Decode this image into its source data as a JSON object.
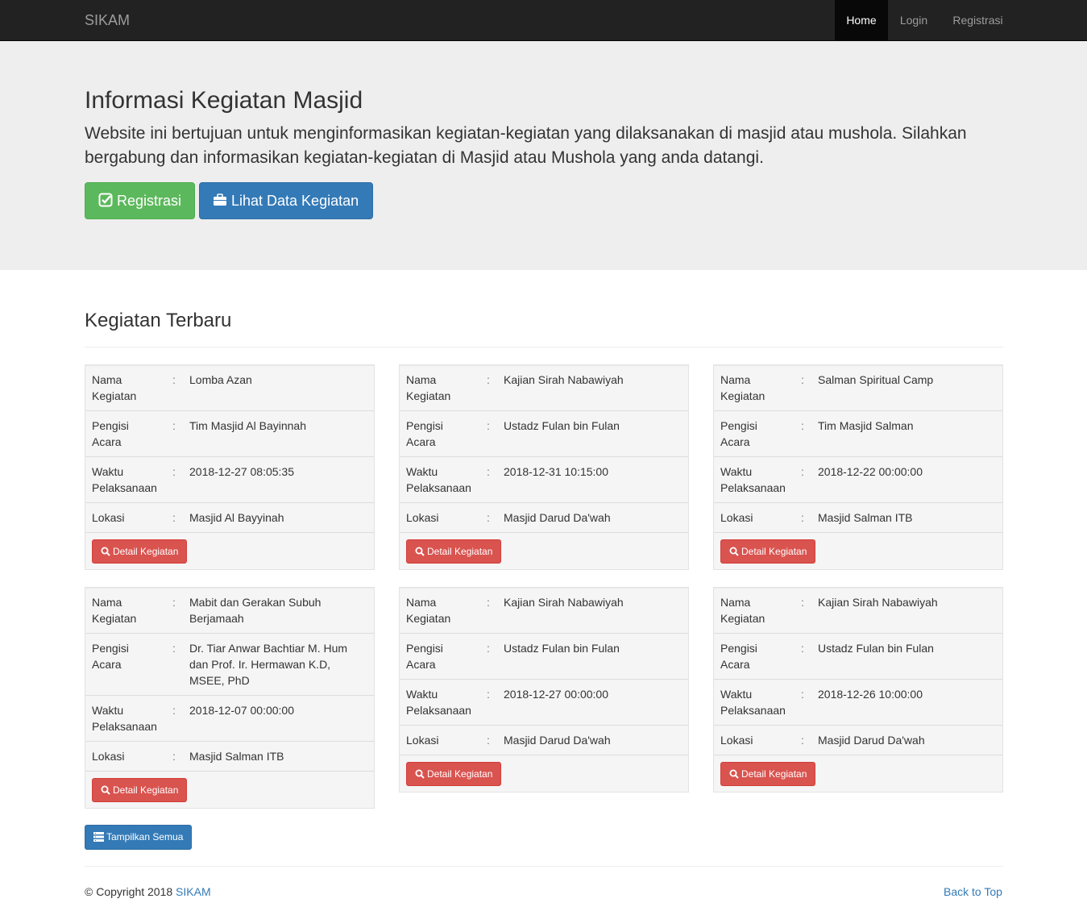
{
  "navbar": {
    "brand": "SIKAM",
    "links": [
      {
        "label": "Home",
        "active": true
      },
      {
        "label": "Login",
        "active": false
      },
      {
        "label": "Registrasi",
        "active": false
      }
    ]
  },
  "hero": {
    "title": "Informasi Kegiatan Masjid",
    "description": "Website ini bertujuan untuk menginformasikan kegiatan-kegiatan yang dilaksanakan di masjid atau mushola. Silahkan bergabung dan informasikan kegiatan-kegiatan di Masjid atau Mushola yang anda datangi.",
    "register_button": {
      "label": "Registrasi",
      "icon": "check-square-icon",
      "color": "#5cb85c"
    },
    "view_button": {
      "label": "Lihat Data Kegiatan",
      "icon": "briefcase-icon",
      "color": "#337ab7"
    }
  },
  "section": {
    "title": "Kegiatan Terbaru",
    "field_labels": {
      "nama": "Nama Kegiatan",
      "pengisi": "Pengisi Acara",
      "waktu": "Waktu Pelaksanaan",
      "lokasi": "Lokasi"
    },
    "separator": ":",
    "detail_button": {
      "label": "Detail Kegiatan",
      "icon": "search-icon",
      "color": "#d9534f"
    },
    "events": [
      {
        "nama": "Lomba Azan",
        "pengisi": "Tim Masjid Al Bayinnah",
        "waktu": "2018-12-27 08:05:35",
        "lokasi": "Masjid Al Bayyinah"
      },
      {
        "nama": "Kajian Sirah Nabawiyah",
        "pengisi": "Ustadz Fulan bin Fulan",
        "waktu": "2018-12-31 10:15:00",
        "lokasi": "Masjid Darud Da'wah"
      },
      {
        "nama": "Salman Spiritual Camp",
        "pengisi": "Tim Masjid Salman",
        "waktu": "2018-12-22 00:00:00",
        "lokasi": "Masjid Salman ITB"
      },
      {
        "nama": "Mabit dan Gerakan Subuh Berjamaah",
        "pengisi": "Dr. Tiar Anwar Bachtiar M. Hum dan Prof. Ir. Hermawan K.D, MSEE, PhD",
        "waktu": "2018-12-07 00:00:00",
        "lokasi": "Masjid Salman ITB"
      },
      {
        "nama": "Kajian Sirah Nabawiyah",
        "pengisi": "Ustadz Fulan bin Fulan",
        "waktu": "2018-12-27 00:00:00",
        "lokasi": "Masjid Darud Da'wah"
      },
      {
        "nama": "Kajian Sirah Nabawiyah",
        "pengisi": "Ustadz Fulan bin Fulan",
        "waktu": "2018-12-26 10:00:00",
        "lokasi": "Masjid Darud Da'wah"
      }
    ],
    "show_all_button": {
      "label": "Tampilkan Semua",
      "icon": "list-icon",
      "color": "#337ab7"
    }
  },
  "footer": {
    "copyright_prefix": "© Copyright 2018",
    "copyright_link": "SIKAM",
    "back_to_top": "Back to Top"
  }
}
